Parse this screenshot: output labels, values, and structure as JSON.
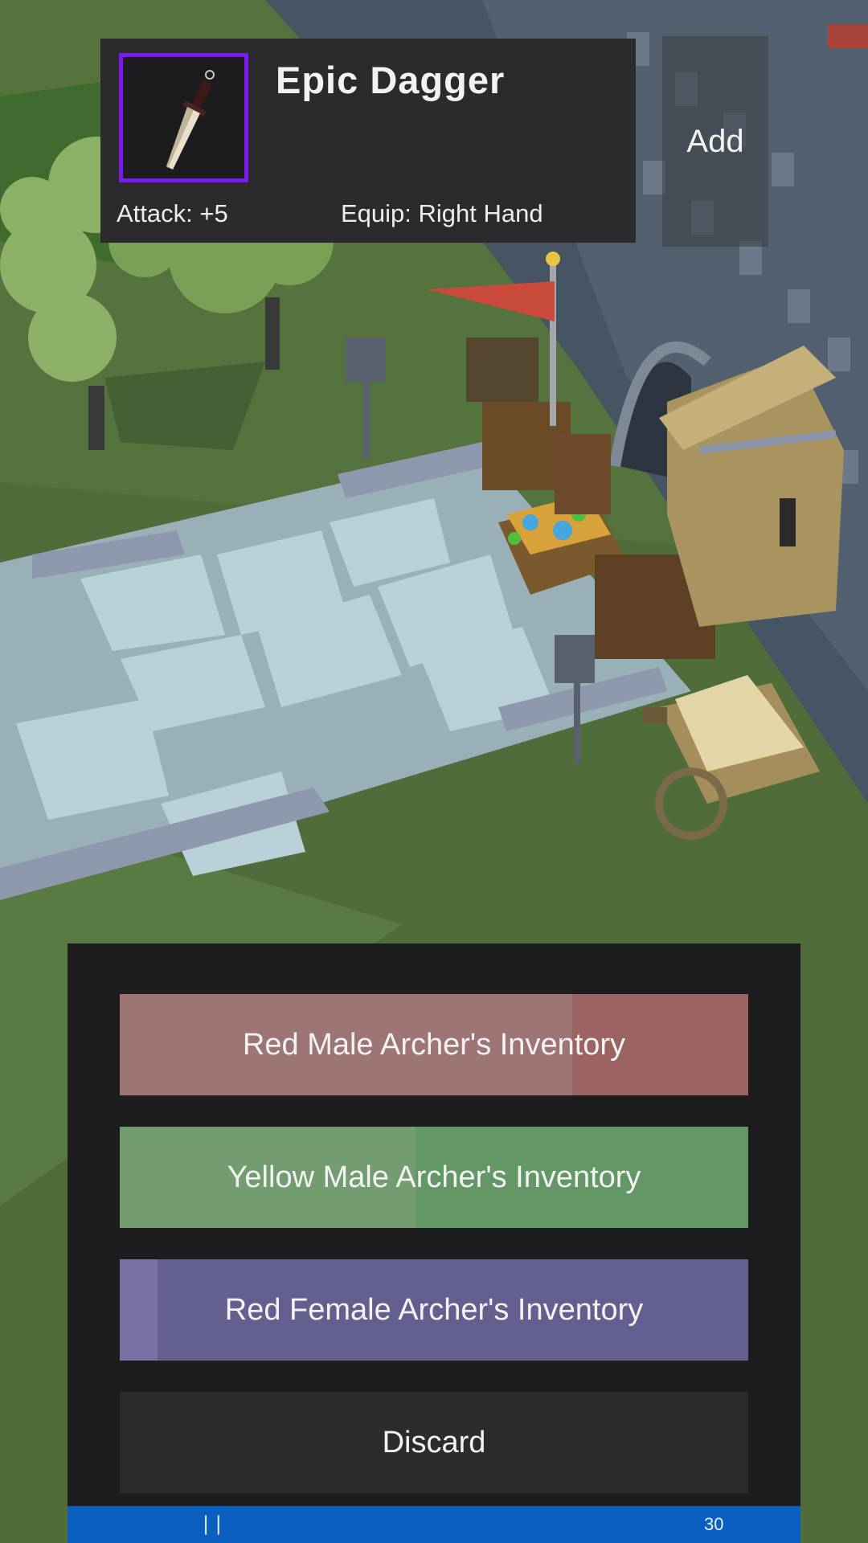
{
  "item": {
    "name": "Epic Dagger",
    "attack": "Attack: +5",
    "equip": "Equip: Right Hand",
    "rarity_color": "#7a1cf0",
    "icon": "dagger-icon"
  },
  "actions": {
    "add_label": "Add"
  },
  "inventory": {
    "buttons": [
      {
        "label": "Red Male Archer's Inventory",
        "color": "#9b6362",
        "progress": 0.72
      },
      {
        "label": "Yellow Male Archer's Inventory",
        "color": "#649766",
        "progress": 0.47
      },
      {
        "label": "Red Female Archer's Inventory",
        "color": "#63608f",
        "progress": 0.06
      }
    ],
    "discard_label": "Discard"
  },
  "status": {
    "pause_glyph": "| |",
    "count": "30"
  }
}
